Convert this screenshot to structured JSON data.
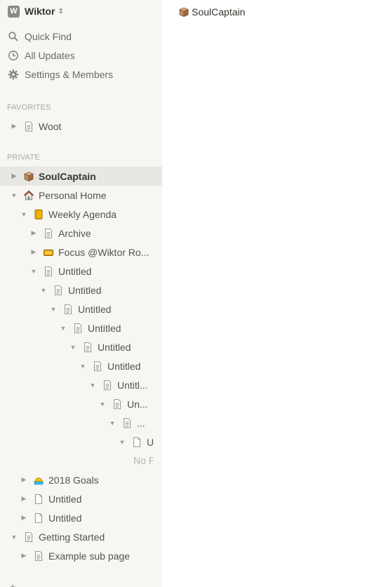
{
  "workspace": {
    "logo_letter": "W",
    "name": "Wiktor",
    "switch_icon": "chevron-up-down-icon"
  },
  "nav": {
    "quick_find": "Quick Find",
    "all_updates": "All Updates",
    "settings": "Settings & Members"
  },
  "sections": {
    "favorites": "FAVORITES",
    "private": "PRIVATE"
  },
  "favorites": [
    {
      "label": "Woot",
      "icon": "page-icon"
    }
  ],
  "pages": [
    {
      "label": "SoulCaptain",
      "icon": "box-emoji-icon"
    },
    {
      "label": "Personal Home",
      "icon": "house-emoji-icon"
    },
    {
      "label": "Weekly Agenda",
      "icon": "notebook-emoji-icon"
    },
    {
      "label": "Archive",
      "icon": "page-icon"
    },
    {
      "label": "Focus @Wiktor Ro...",
      "icon": "ticket-emoji-icon"
    },
    {
      "label": "Untitled",
      "icon": "page-icon"
    },
    {
      "label": "Untitled",
      "icon": "page-icon"
    },
    {
      "label": "Untitled",
      "icon": "page-icon"
    },
    {
      "label": "Untitled",
      "icon": "page-icon"
    },
    {
      "label": "Untitled",
      "icon": "page-icon"
    },
    {
      "label": "Untitled",
      "icon": "page-icon"
    },
    {
      "label": "Untitl...",
      "icon": "page-icon"
    },
    {
      "label": "Un...",
      "icon": "page-icon"
    },
    {
      "label": "...",
      "icon": "page-icon"
    },
    {
      "label": "U",
      "icon": "blank-page-icon"
    },
    {
      "label": "2018 Goals",
      "icon": "sunrise-emoji-icon"
    },
    {
      "label": "Untitled",
      "icon": "blank-page-icon"
    },
    {
      "label": "Untitled",
      "icon": "blank-page-icon"
    },
    {
      "label": "Getting Started",
      "icon": "page-icon"
    },
    {
      "label": "Example sub page",
      "icon": "page-icon"
    }
  ],
  "empty_text": "No P",
  "footer": {
    "new_page": "+ "
  },
  "breadcrumb": {
    "label": "SoulCaptain",
    "icon": "box-emoji-icon"
  },
  "colors": {
    "sidebar_bg": "#f7f6f3",
    "active_row": "#e8e7e4",
    "text": "#37352f",
    "muted": "#9b9a97"
  }
}
